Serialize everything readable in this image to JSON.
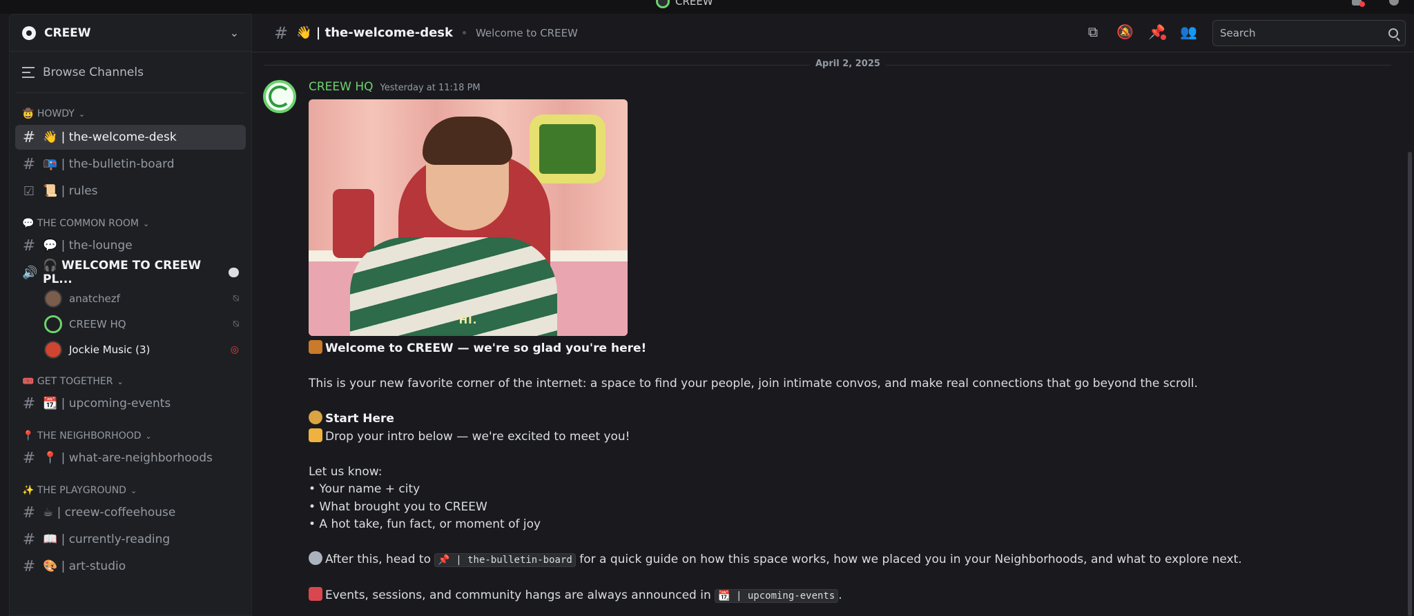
{
  "window": {
    "title": "CREEW"
  },
  "sidebar": {
    "server_name": "CREEW",
    "browse_label": "Browse Channels",
    "categories": [
      {
        "label": "🤠 HOWDY",
        "channels": [
          {
            "label": "👋 | the-welcome-desk",
            "active": true
          },
          {
            "label": "📭 | the-bulletin-board"
          },
          {
            "label": "📜 | rules",
            "icon": "checkbox"
          }
        ]
      },
      {
        "label": "💬 THE COMMON ROOM",
        "channels": [
          {
            "label": "💬 | the-lounge"
          }
        ]
      }
    ],
    "voice_channel": {
      "label": "🎧 WELCOME TO CREEW PL...",
      "users": [
        {
          "name": "anatchezf"
        },
        {
          "name": "CREEW HQ"
        },
        {
          "name": "Jockie Music (3)"
        }
      ]
    },
    "categories2": [
      {
        "label": "🎟️ GET TOGETHER",
        "channels": [
          {
            "label": "📆 | upcoming-events"
          }
        ]
      },
      {
        "label": "📍 THE NEIGHBORHOOD",
        "channels": [
          {
            "label": "📍 | what-are-neighborhoods"
          }
        ]
      },
      {
        "label": "✨ THE PLAYGROUND",
        "channels": [
          {
            "label": "☕ | creew-coffeehouse"
          },
          {
            "label": "📖 | currently-reading"
          },
          {
            "label": "🎨 | art-studio"
          }
        ]
      }
    ]
  },
  "header": {
    "channel_name": "👋 | the-welcome-desk",
    "topic": "Welcome to CREEW",
    "search_placeholder": "Search"
  },
  "chat": {
    "date_divider": "April 2, 2025",
    "message": {
      "author": "CREEW HQ",
      "timestamp": "Yesterday at 11:18 PM",
      "gif_caption": "HI.",
      "line_welcome": "Welcome to CREEW — we're so glad you're here!",
      "line_intro": "This is your new favorite corner of the internet: a space to find your people, join intimate convos, and make real connections that go beyond the scroll.",
      "start_here": "Start Here",
      "drop_intro": "Drop your intro below — we're excited to meet you!",
      "let_us_know": "Let us know:",
      "bullets": [
        "• Your name + city",
        "• What brought you to CREEW",
        "• A hot take, fun fact, or moment of joy"
      ],
      "after_prefix": "After this, head to",
      "after_channel": "📌 | the-bulletin-board",
      "after_suffix": "for a quick guide on how this space works, how we placed you in your Neighborhoods, and what to explore next.",
      "events_prefix": "Events, sessions, and community hangs are always announced in",
      "events_channel": "📆 | upcoming-events",
      "events_suffix": "."
    }
  },
  "colors": {
    "accent_green": "#6dd36f",
    "active_bg": "#35373c",
    "danger_red": "#f23f43"
  }
}
